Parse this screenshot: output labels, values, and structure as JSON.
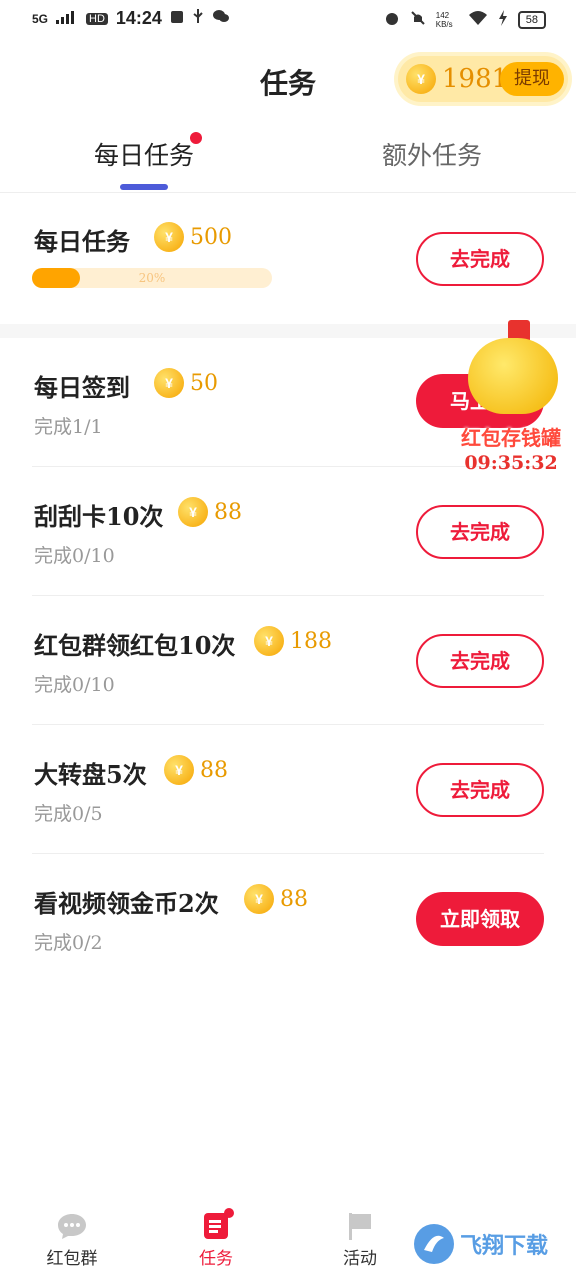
{
  "status_bar": {
    "network": "5G",
    "hd": "HD",
    "time": "14:24",
    "speed": "142 KB/s",
    "battery": "58"
  },
  "header": {
    "title": "任务",
    "coin_symbol": "¥",
    "coin_balance": "1981",
    "withdraw_label": "提现"
  },
  "tabs": [
    {
      "label": "每日任务",
      "active": true,
      "has_dot": true
    },
    {
      "label": "额外任务",
      "active": false
    }
  ],
  "daily_summary": {
    "title": "每日任务",
    "reward": "500",
    "progress_text": "20%",
    "progress": 0.2,
    "button": "去完成"
  },
  "tasks": [
    {
      "title": "每日签到",
      "reward": "50",
      "progress": "完成1/1",
      "button": "马上领",
      "button_style": "filled"
    },
    {
      "title": "刮刮卡10次",
      "reward": "88",
      "progress": "完成0/10",
      "button": "去完成",
      "button_style": "outline"
    },
    {
      "title": "红包群领红包10次",
      "reward": "188",
      "progress": "完成0/10",
      "button": "去完成",
      "button_style": "outline"
    },
    {
      "title": "大转盘5次",
      "reward": "88",
      "progress": "完成0/5",
      "button": "去完成",
      "button_style": "outline"
    },
    {
      "title": "看视频领金币2次",
      "reward": "88",
      "progress": "完成0/2",
      "button": "立即领取",
      "button_style": "filled"
    }
  ],
  "float_badge": {
    "label": "红包存钱罐",
    "timer": "09:35:32"
  },
  "bottom_nav": [
    {
      "label": "红包群",
      "icon": "chat-bubble-icon"
    },
    {
      "label": "任务",
      "icon": "task-list-icon",
      "active": true
    },
    {
      "label": "活动",
      "icon": "flag-icon"
    }
  ],
  "watermark": {
    "text": "飞翔下载"
  },
  "colors": {
    "accent_red": "#ee1b3a",
    "coin_gold": "#ffa400",
    "tab_indicator": "#4d5bd9"
  }
}
